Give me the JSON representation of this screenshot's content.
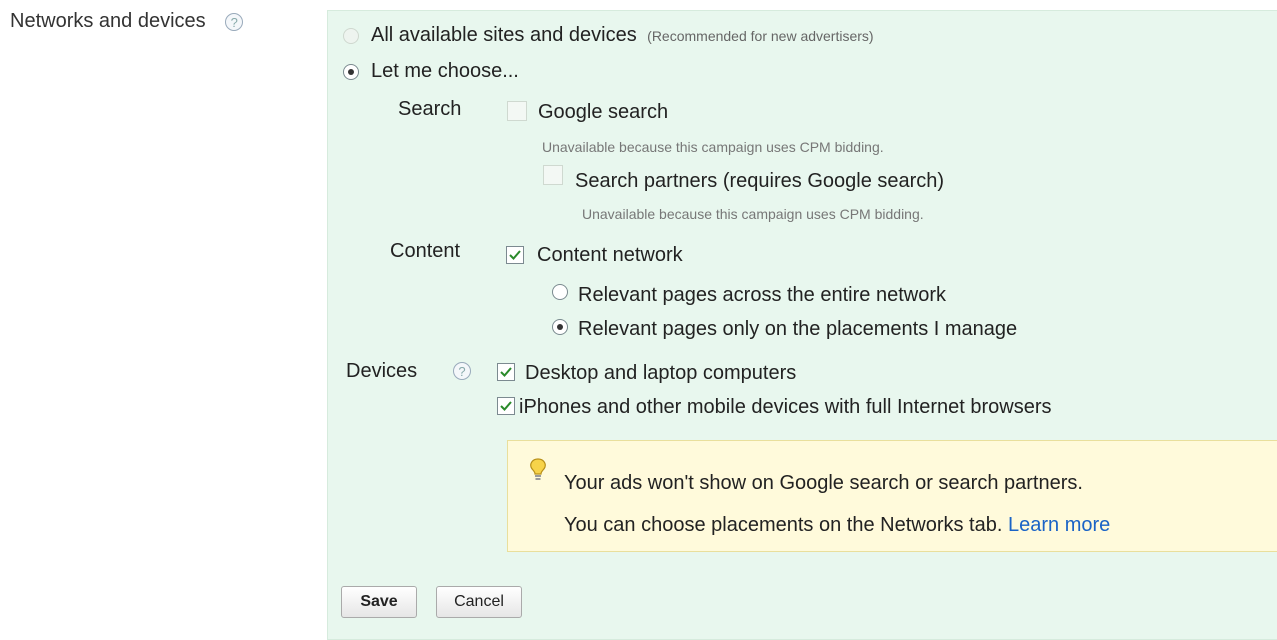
{
  "section": {
    "label": "Networks and devices",
    "help_glyph": "?"
  },
  "networks": {
    "all_option": "All available sites and devices",
    "all_note": "(Recommended for new advertisers)",
    "choose_option": "Let me choose..."
  },
  "search": {
    "label": "Search",
    "google_search": "Google search",
    "google_search_note": "Unavailable because this campaign uses CPM bidding.",
    "partners": "Search partners (requires Google search)",
    "partners_note": "Unavailable because this campaign uses CPM bidding."
  },
  "content": {
    "label": "Content",
    "network": "Content network",
    "option_entire": "Relevant pages across the entire network",
    "option_placements": "Relevant pages only on the placements I manage"
  },
  "devices": {
    "label": "Devices",
    "help_glyph": "?",
    "desktop": "Desktop and laptop computers",
    "mobile": "iPhones and other mobile devices with full Internet browsers"
  },
  "tip": {
    "line1": "Your ads won't show on Google search or search partners.",
    "line2": "You can choose placements on the Networks tab.",
    "link": "Learn more"
  },
  "buttons": {
    "save": "Save",
    "cancel": "Cancel"
  },
  "colors": {
    "panel_bg": "#e8f7ee",
    "tip_bg": "#fffadb",
    "link": "#1a63c6",
    "check": "#2a8a2a"
  }
}
